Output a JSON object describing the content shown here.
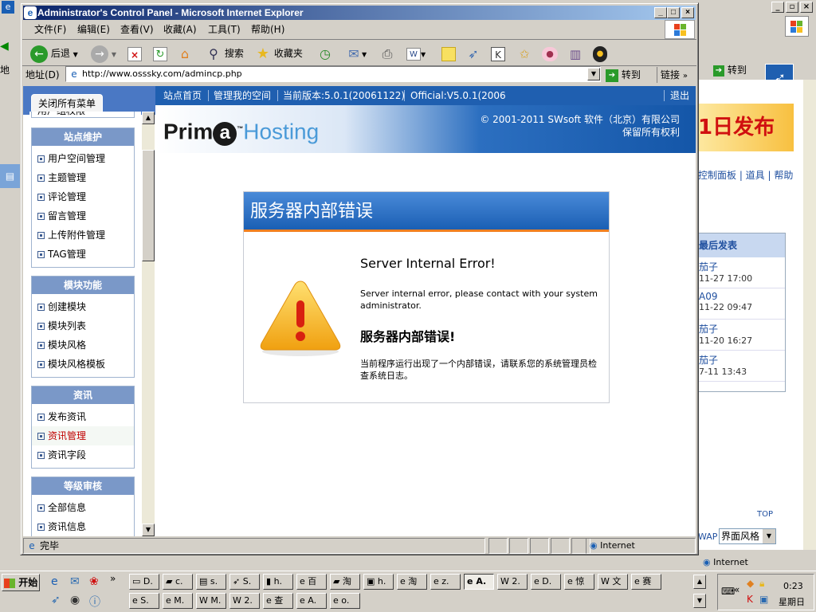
{
  "background_window": {
    "menu_char": "地",
    "go_label": "转到",
    "banner_text": "1日发布",
    "links": "控制面板 | 道具 | 帮助",
    "latest_title": "最后发表",
    "posts": [
      {
        "name": "茄子",
        "time": "11-27 17:00"
      },
      {
        "name": "A09",
        "time": "11-22 09:47"
      },
      {
        "name": "茄子",
        "time": "11-20 16:27"
      },
      {
        "name": "茄子",
        "time": "7-11 13:43"
      }
    ],
    "top_label": "TOP",
    "wap_label": "WAP",
    "style_select": "界面风格",
    "status_zone": "Internet"
  },
  "window": {
    "title": "Administrator's Control Panel - Microsoft Internet Explorer"
  },
  "menubar": [
    "文件(F)",
    "编辑(E)",
    "查看(V)",
    "收藏(A)",
    "工具(T)",
    "帮助(H)"
  ],
  "toolbar": {
    "back_label": "后退",
    "search_label": "搜索",
    "favorites_label": "收藏夹"
  },
  "addressbar": {
    "label": "地址(D)",
    "url": "http://www.osssky.com/admincp.php",
    "go_label": "转到",
    "links_label": "链接"
  },
  "page": {
    "close_all_menu": "关闭所有菜单",
    "nav": [
      "站点首页",
      "管理我的空间",
      "当前版本:5.0.1(20061122)",
      "Official:V5.0.1(2006"
    ],
    "logout": "退出",
    "logo_prim": "Prim",
    "logo_a": "a",
    "logo_hosting": "Hosting",
    "copyright_line1": "© 2001-2011 SWsoft 软件（北京）有限公司",
    "copyright_line2": "保留所有权利",
    "sidebar_cut_item": "用户组权限",
    "sidebar": [
      {
        "title": "站点维护",
        "items": [
          "用户空间管理",
          "主题管理",
          "评论管理",
          "留言管理",
          "上传附件管理",
          "TAG管理"
        ]
      },
      {
        "title": "模块功能",
        "items": [
          "创建模块",
          "模块列表",
          "模块风格",
          "模块风格模板"
        ]
      },
      {
        "title": "资讯",
        "items": [
          "发布资讯",
          "资讯管理",
          "资讯字段"
        ],
        "active": "资讯管理"
      },
      {
        "title": "等级审核",
        "items": [
          "全部信息",
          "资讯信息"
        ]
      }
    ],
    "error": {
      "header": "服务器内部错误",
      "title_en": "Server Internal Error!",
      "msg_en": "Server internal error, please contact with your system administrator.",
      "title_cn": "服务器内部错误!",
      "msg_cn": "当前程序运行出现了一个内部错误，请联系您的系统管理员检查系统日志。"
    }
  },
  "statusbar": {
    "text": "完毕",
    "zone": "Internet"
  },
  "taskbar": {
    "start": "开始",
    "row1": [
      "D.",
      "c.",
      "s.",
      "S.",
      "h.",
      "百",
      "淘",
      "h.",
      "淘",
      "z.",
      "A.",
      "2.",
      "D.",
      "惊",
      "文",
      "赛"
    ],
    "row2": [
      "S.",
      "M.",
      "M.",
      "2.",
      "查",
      "A.",
      "o."
    ],
    "clock": "0:23",
    "day": "星期日"
  },
  "colors": {
    "titlebar": "#0a246a",
    "nav": "#1f5fb0",
    "error_header": "#1a5fb4",
    "error_accent": "#f08020",
    "active_item": "#c00000"
  }
}
